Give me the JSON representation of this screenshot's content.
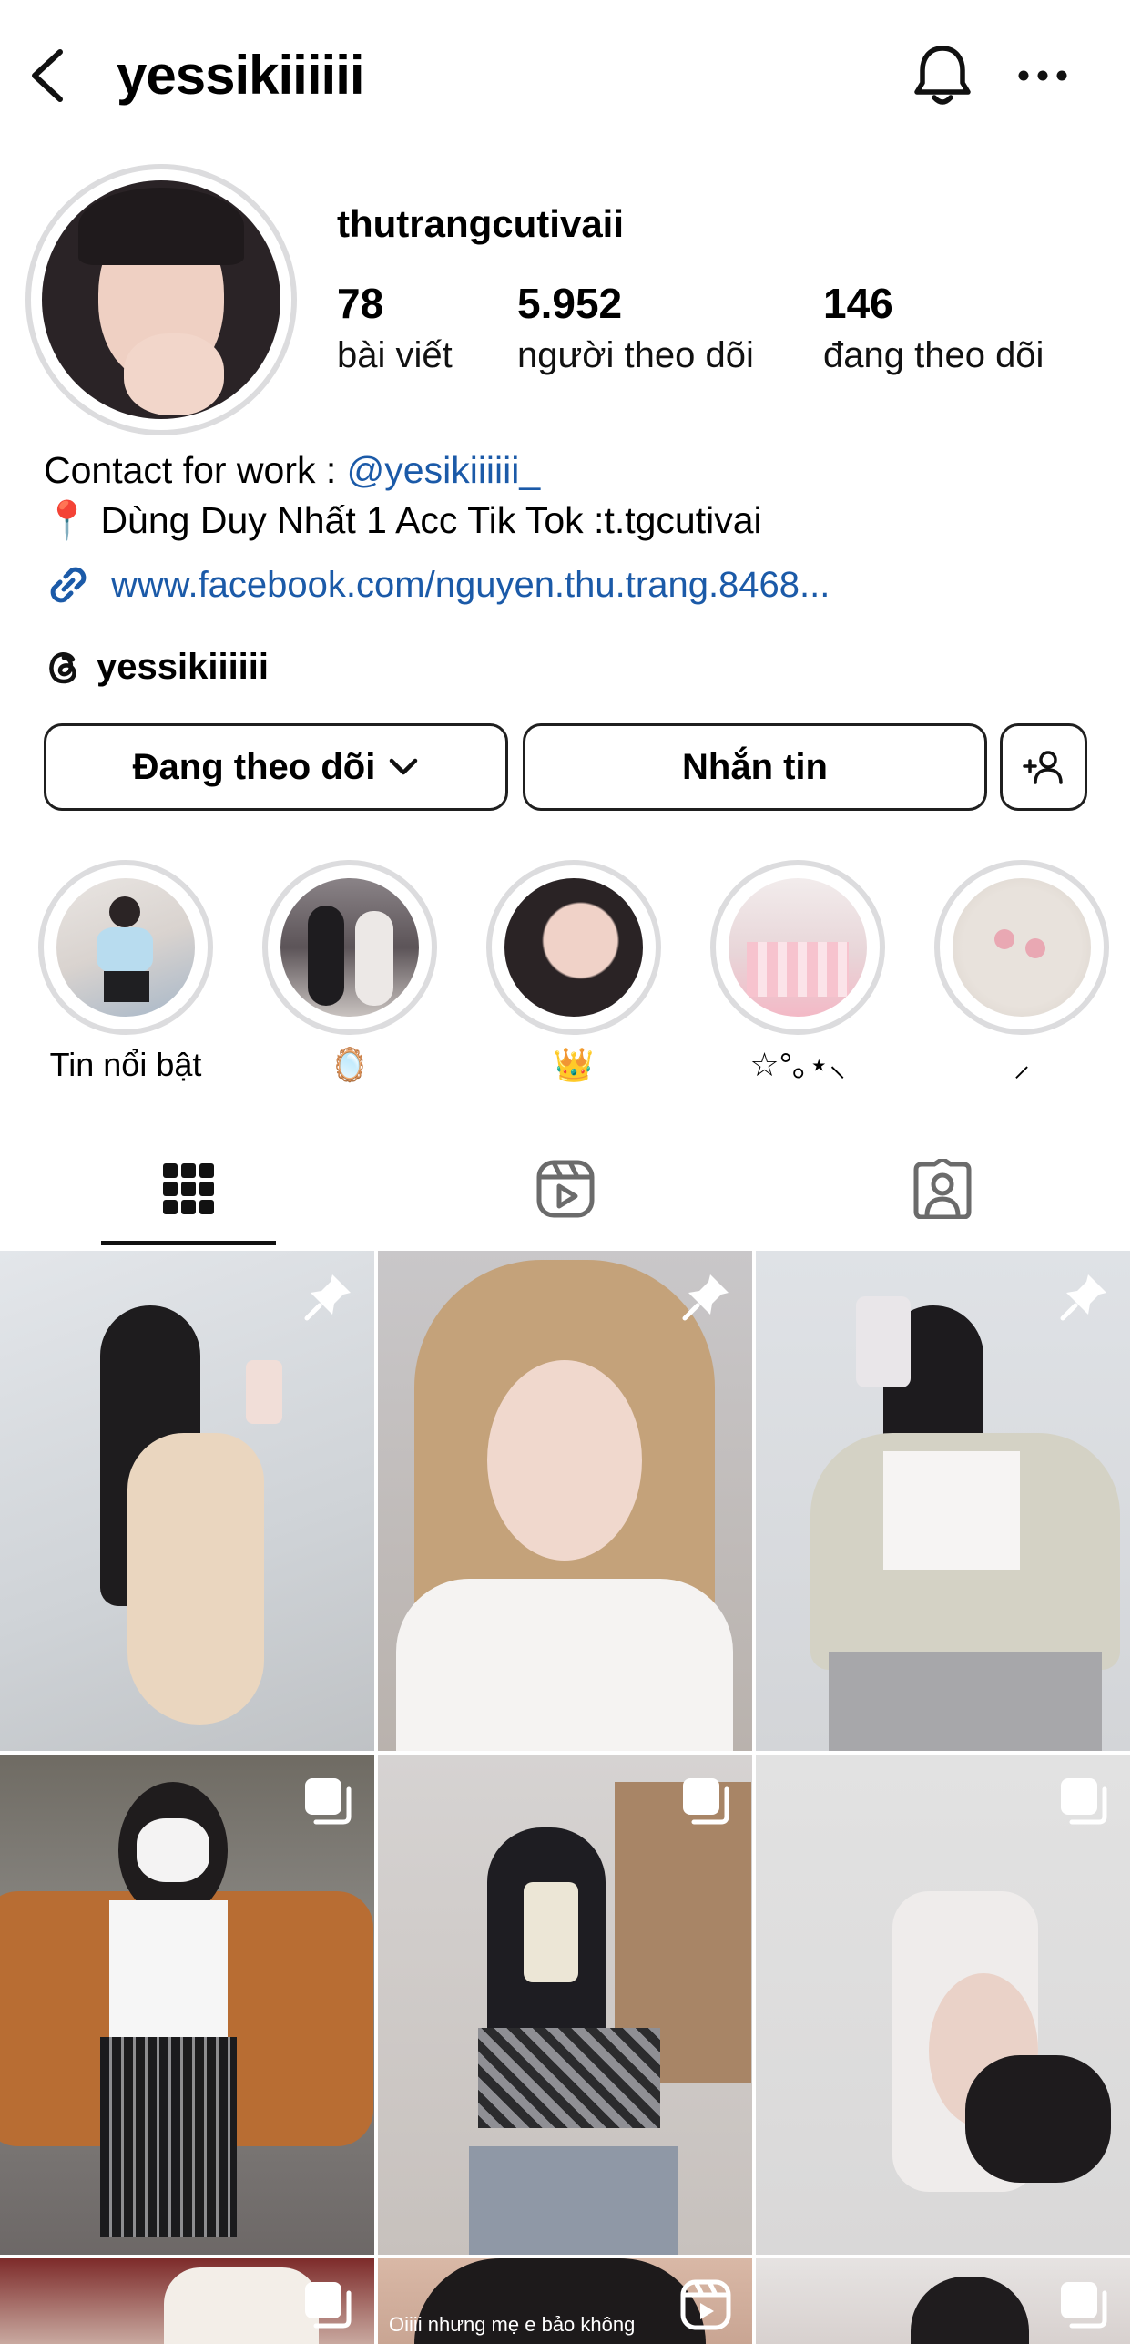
{
  "header": {
    "title": "yessikiiiiii"
  },
  "profile": {
    "username": "thutrangcutivaii",
    "stats": [
      {
        "num": "78",
        "label": "bài viết"
      },
      {
        "num": "5.952",
        "label": "người theo dõi"
      },
      {
        "num": "146",
        "label": "đang theo dõi"
      }
    ],
    "bio_contact_prefix": "Contact for work : ",
    "bio_contact_handle": "@yesikiiiiii_",
    "bio_line2": "📍 Dùng Duy Nhất 1 Acc Tik Tok :t.tgcutivai",
    "link": "www.facebook.com/nguyen.thu.trang.8468...",
    "threads_handle": "yessikiiiiii"
  },
  "actions": {
    "follow_label": "Đang theo dõi",
    "message_label": "Nhắn tin"
  },
  "highlights": [
    {
      "label": "Tin nổi bật"
    },
    {
      "label": "🪞"
    },
    {
      "label": "👑"
    },
    {
      "label": "☆°｡⋆⸜"
    },
    {
      "label": "⸝"
    }
  ],
  "tabs": [
    {
      "icon": "grid-icon",
      "active": true
    },
    {
      "icon": "reels-icon",
      "active": false
    },
    {
      "icon": "tagged-icon",
      "active": false
    }
  ],
  "grid": {
    "posts": [
      {
        "badge": "pin-icon"
      },
      {
        "badge": "pin-icon"
      },
      {
        "badge": "pin-icon"
      },
      {
        "badge": "carousel-icon"
      },
      {
        "badge": "carousel-icon"
      },
      {
        "badge": "carousel-icon"
      },
      {
        "badge": "carousel-icon"
      },
      {
        "badge": "reels-icon",
        "caption": "Oiiii nhưng mẹ e bảo không"
      },
      {
        "badge": "carousel-icon"
      }
    ]
  }
}
